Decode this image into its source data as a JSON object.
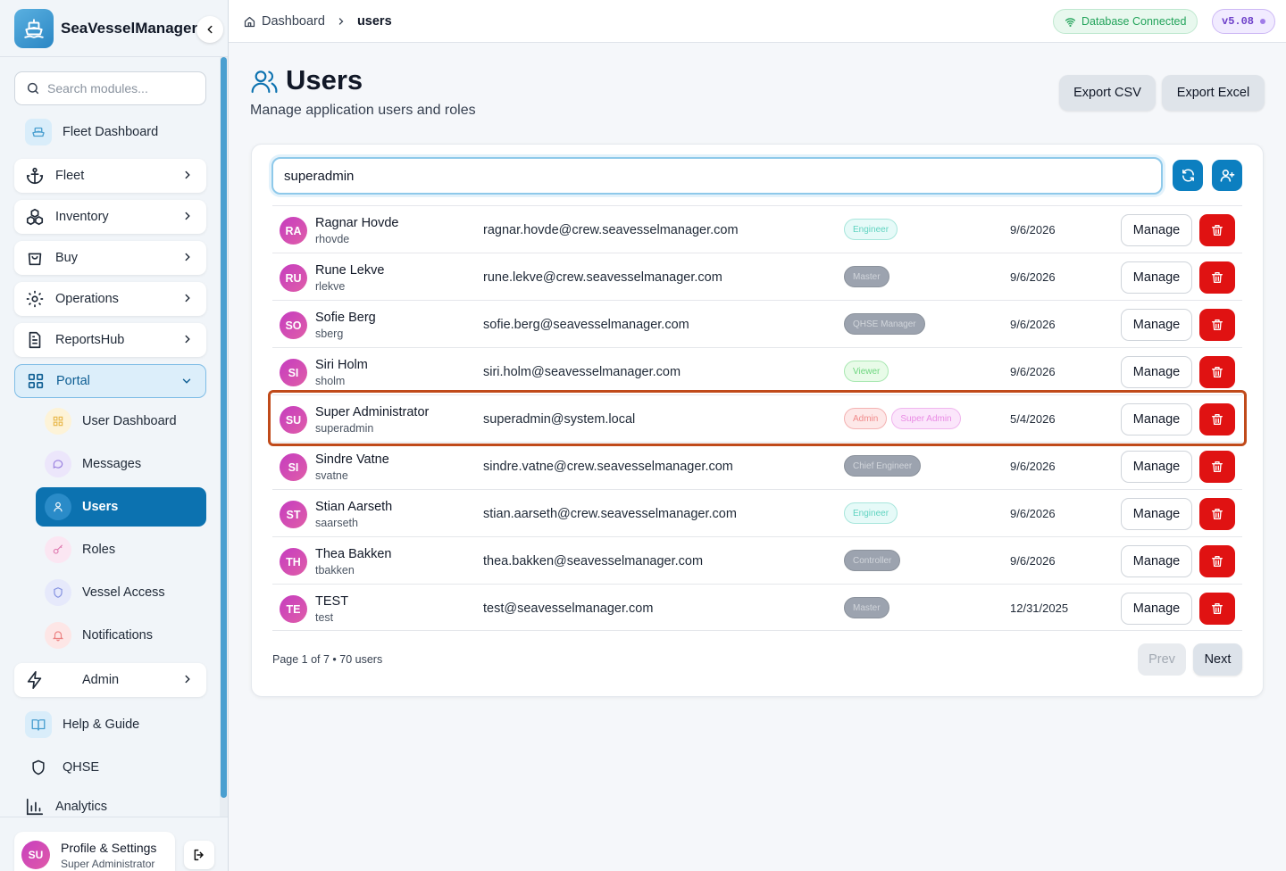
{
  "app": {
    "name": "SeaVesselManager"
  },
  "sidebar": {
    "search_placeholder": "Search modules...",
    "items": [
      {
        "label": "Fleet Dashboard",
        "icon": "ship-icon"
      },
      {
        "label": "Fleet",
        "icon": "anchor-icon"
      },
      {
        "label": "Inventory",
        "icon": "boxes-icon"
      },
      {
        "label": "Buy",
        "icon": "shopping-bag-icon"
      },
      {
        "label": "Operations",
        "icon": "gear-icon"
      },
      {
        "label": "ReportsHub",
        "icon": "document-icon"
      },
      {
        "label": "Portal",
        "icon": "grid-icon",
        "expanded": true
      },
      {
        "label": "Admin",
        "icon": "lightning-icon"
      },
      {
        "label": "Help & Guide",
        "icon": "book-icon"
      },
      {
        "label": "QHSE",
        "icon": "shield-icon"
      },
      {
        "label": "Analytics",
        "icon": "bar-chart-icon"
      }
    ],
    "portal_sub": [
      {
        "label": "User Dashboard",
        "icon": "dashboard-icon"
      },
      {
        "label": "Messages",
        "icon": "message-icon"
      },
      {
        "label": "Users",
        "icon": "user-icon",
        "active": true
      },
      {
        "label": "Roles",
        "icon": "key-icon"
      },
      {
        "label": "Vessel Access",
        "icon": "shield-icon"
      },
      {
        "label": "Notifications",
        "icon": "bell-icon"
      }
    ],
    "profile": {
      "initials": "SU",
      "title": "Profile & Settings",
      "subtitle": "Super Administrator"
    }
  },
  "topbar": {
    "breadcrumb": [
      "Dashboard",
      "users"
    ],
    "db_status": "Database Connected",
    "version": "v5.08"
  },
  "header": {
    "title": "Users",
    "subtitle": "Manage application users and roles",
    "export_csv": "Export CSV",
    "export_excel": "Export Excel"
  },
  "filter": {
    "value": "superadmin"
  },
  "users": [
    {
      "initials": "RA",
      "name": "Ragnar Hovde",
      "username": "rhovde",
      "email": "ragnar.hovde@crew.seavesselmanager.com",
      "roles": [
        {
          "label": "Engineer",
          "style": "eng"
        }
      ],
      "date": "9/6/2026"
    },
    {
      "initials": "RU",
      "name": "Rune Lekve",
      "username": "rlekve",
      "email": "rune.lekve@crew.seavesselmanager.com",
      "roles": [
        {
          "label": "Master",
          "style": "gray"
        }
      ],
      "date": "9/6/2026"
    },
    {
      "initials": "SO",
      "name": "Sofie Berg",
      "username": "sberg",
      "email": "sofie.berg@seavesselmanager.com",
      "roles": [
        {
          "label": "QHSE Manager",
          "style": "gray"
        }
      ],
      "date": "9/6/2026"
    },
    {
      "initials": "SI",
      "name": "Siri Holm",
      "username": "sholm",
      "email": "siri.holm@seavesselmanager.com",
      "roles": [
        {
          "label": "Viewer",
          "style": "viewer"
        }
      ],
      "date": "9/6/2026"
    },
    {
      "initials": "SU",
      "name": "Super Administrator",
      "username": "superadmin",
      "email": "superadmin@system.local",
      "roles": [
        {
          "label": "Admin",
          "style": "admin"
        },
        {
          "label": "Super Admin",
          "style": "super"
        }
      ],
      "date": "5/4/2026",
      "highlighted": true
    },
    {
      "initials": "SI",
      "name": "Sindre Vatne",
      "username": "svatne",
      "email": "sindre.vatne@crew.seavesselmanager.com",
      "roles": [
        {
          "label": "Chief Engineer",
          "style": "gray"
        }
      ],
      "date": "9/6/2026"
    },
    {
      "initials": "ST",
      "name": "Stian Aarseth",
      "username": "saarseth",
      "email": "stian.aarseth@crew.seavesselmanager.com",
      "roles": [
        {
          "label": "Engineer",
          "style": "eng"
        }
      ],
      "date": "9/6/2026"
    },
    {
      "initials": "TH",
      "name": "Thea Bakken",
      "username": "tbakken",
      "email": "thea.bakken@seavesselmanager.com",
      "roles": [
        {
          "label": "Controller",
          "style": "gray"
        }
      ],
      "date": "9/6/2026"
    },
    {
      "initials": "TE",
      "name": "TEST",
      "username": "test",
      "email": "test@seavesselmanager.com",
      "roles": [
        {
          "label": "Master",
          "style": "gray"
        }
      ],
      "date": "12/31/2025"
    }
  ],
  "row_actions": {
    "manage": "Manage"
  },
  "pagination": {
    "info": "Page 1 of 7 • 70 users",
    "prev": "Prev",
    "next": "Next"
  },
  "colors": {
    "primary": "#0c72b0",
    "danger": "#e01212",
    "highlight": "#c04a1a",
    "db_ok": "#22a35a"
  }
}
